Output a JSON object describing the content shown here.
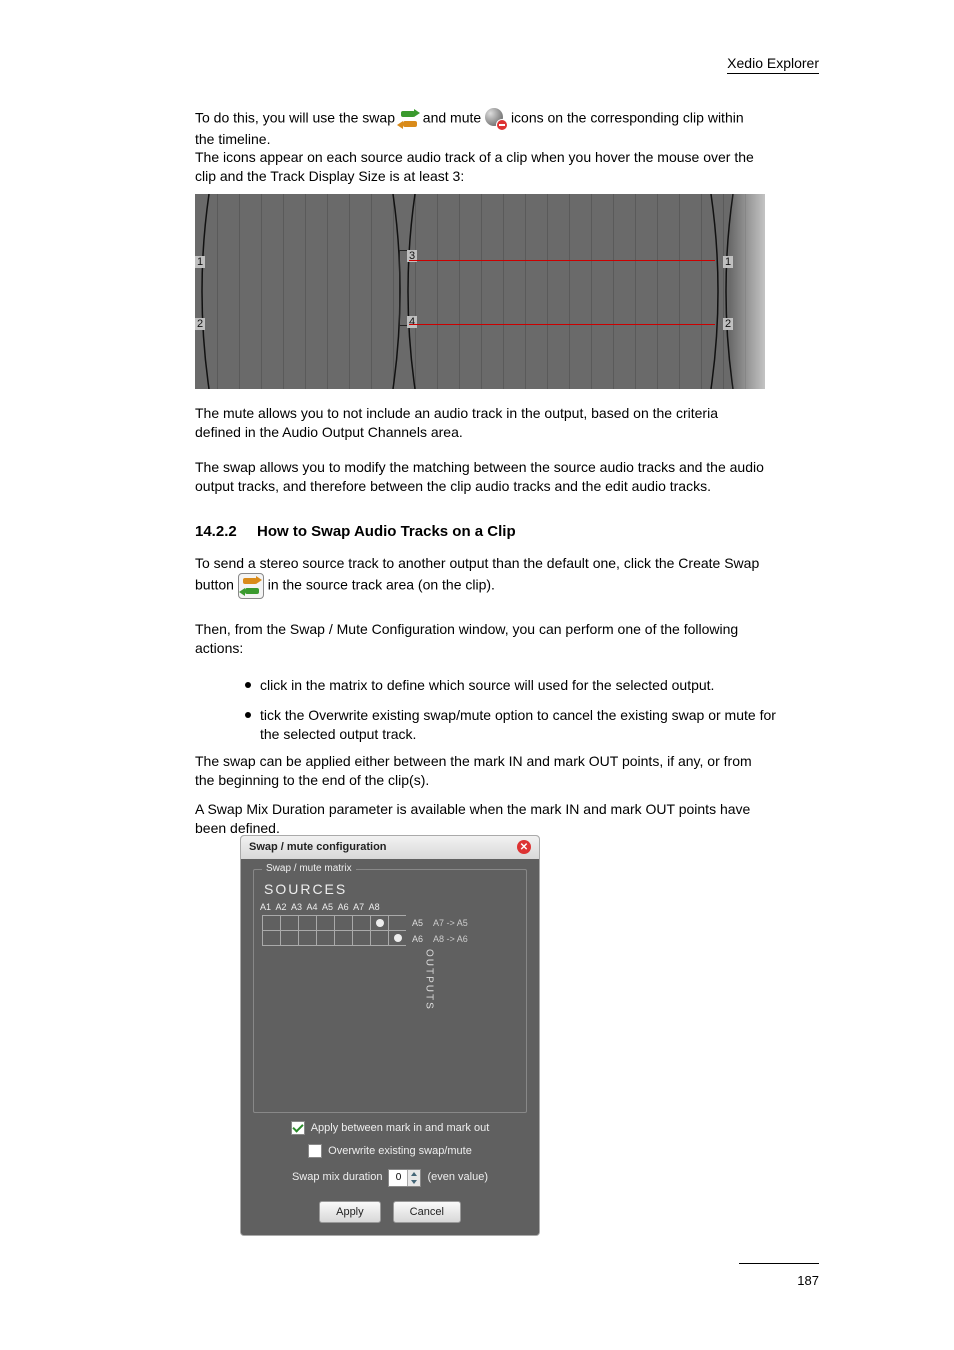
{
  "header": {
    "title": "Xedio Explorer"
  },
  "intro": {
    "pre_swap": "To do this, you will use the swap ",
    "mid": " and mute ",
    "post": " icons on the corresponding clip within the timeline.",
    "para2": "The icons appear on each source audio track of a clip when you hover the mouse over the clip and the Track Display Size is at least 3:"
  },
  "timeline": {
    "labels": {
      "l1": "1",
      "l2": "2",
      "l3": "3",
      "l4": "4",
      "r1": "1",
      "r2": "2"
    }
  },
  "principles": {
    "p1": "The mute allows you to not include an audio track in the output, based on the criteria defined in the Audio Output Channels area.",
    "p2": "The swap allows you to modify the matching between the source audio tracks and the audio output tracks, and therefore between the clip audio tracks and the edit audio tracks."
  },
  "how_swap": {
    "h": "14.2.2How to Swap Audio Tracks on a Clip",
    "line1_pre": "To send a stereo source track to another output than the default one, click the Create Swap button ",
    "line1_post": " in the source track area (on the clip).",
    "line2": "Then, from the Swap / Mute Configuration window, you can perform one of the following actions:",
    "b1": "click in the matrix to define which source will used for the selected output.",
    "b2": "tick the Overwrite existing swap/mute option to cancel the existing swap or mute for the selected output track.",
    "line3": "The swap can be applied either between the mark IN and mark OUT points, if any, or from the beginning to the end of the clip(s).",
    "line4": "A Swap Mix Duration parameter is available when the mark IN and mark OUT points have been defined."
  },
  "dialog": {
    "title": "Swap / mute configuration",
    "legend": "Swap / mute matrix",
    "sources": "SOURCES",
    "ahdr": "A1  A2  A3  A4  A5  A6  A7  A8",
    "outputs": "OUTPUTS",
    "row1": {
      "lbl": "A5",
      "map": "A7  ->  A5"
    },
    "row2": {
      "lbl": "A6",
      "map": "A8  ->  A6"
    },
    "opt1": "Apply between mark in and mark out",
    "opt2": "Overwrite existing swap/mute",
    "swapmix_lbl": "Swap mix duration",
    "swapmix_val": "0",
    "swapmix_hint": "(even value)",
    "apply": "Apply",
    "cancel": "Cancel"
  },
  "footer": {
    "page": "187"
  }
}
